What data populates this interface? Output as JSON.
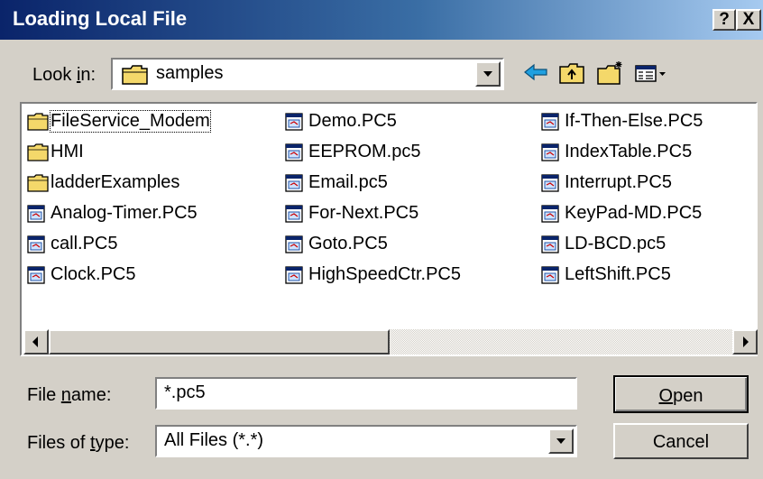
{
  "window": {
    "title": "Loading Local File",
    "help_label": "?",
    "close_label": "X"
  },
  "look_in": {
    "label_before": "Look ",
    "label_accel": "i",
    "label_after": "n:",
    "value": "samples",
    "icon": "folder-icon"
  },
  "toolbar": {
    "back": "back-arrow-icon",
    "up": "up-folder-icon",
    "new": "new-folder-icon",
    "view": "view-menu-icon"
  },
  "files": [
    {
      "name": "FileService_Modem",
      "type": "folder",
      "selected": true
    },
    {
      "name": "HMI",
      "type": "folder"
    },
    {
      "name": "ladderExamples",
      "type": "folder"
    },
    {
      "name": "Analog-Timer.PC5",
      "type": "file"
    },
    {
      "name": "call.PC5",
      "type": "file"
    },
    {
      "name": "Clock.PC5",
      "type": "file"
    },
    {
      "name": "Demo.PC5",
      "type": "file"
    },
    {
      "name": "EEPROM.pc5",
      "type": "file"
    },
    {
      "name": "Email.pc5",
      "type": "file"
    },
    {
      "name": "For-Next.PC5",
      "type": "file"
    },
    {
      "name": "Goto.PC5",
      "type": "file"
    },
    {
      "name": "HighSpeedCtr.PC5",
      "type": "file"
    },
    {
      "name": "If-Then-Else.PC5",
      "type": "file"
    },
    {
      "name": "IndexTable.PC5",
      "type": "file"
    },
    {
      "name": "Interrupt.PC5",
      "type": "file"
    },
    {
      "name": "KeyPad-MD.PC5",
      "type": "file"
    },
    {
      "name": "LD-BCD.pc5",
      "type": "file"
    },
    {
      "name": "LeftShift.PC5",
      "type": "file"
    }
  ],
  "file_name": {
    "label_before": "File ",
    "label_accel": "n",
    "label_after": "ame:",
    "value": "*.pc5"
  },
  "file_type": {
    "label_before": "Files of ",
    "label_accel": "t",
    "label_after": "ype:",
    "value": "All Files (*.*)"
  },
  "buttons": {
    "open_accel": "O",
    "open_rest": "pen",
    "cancel": "Cancel"
  }
}
